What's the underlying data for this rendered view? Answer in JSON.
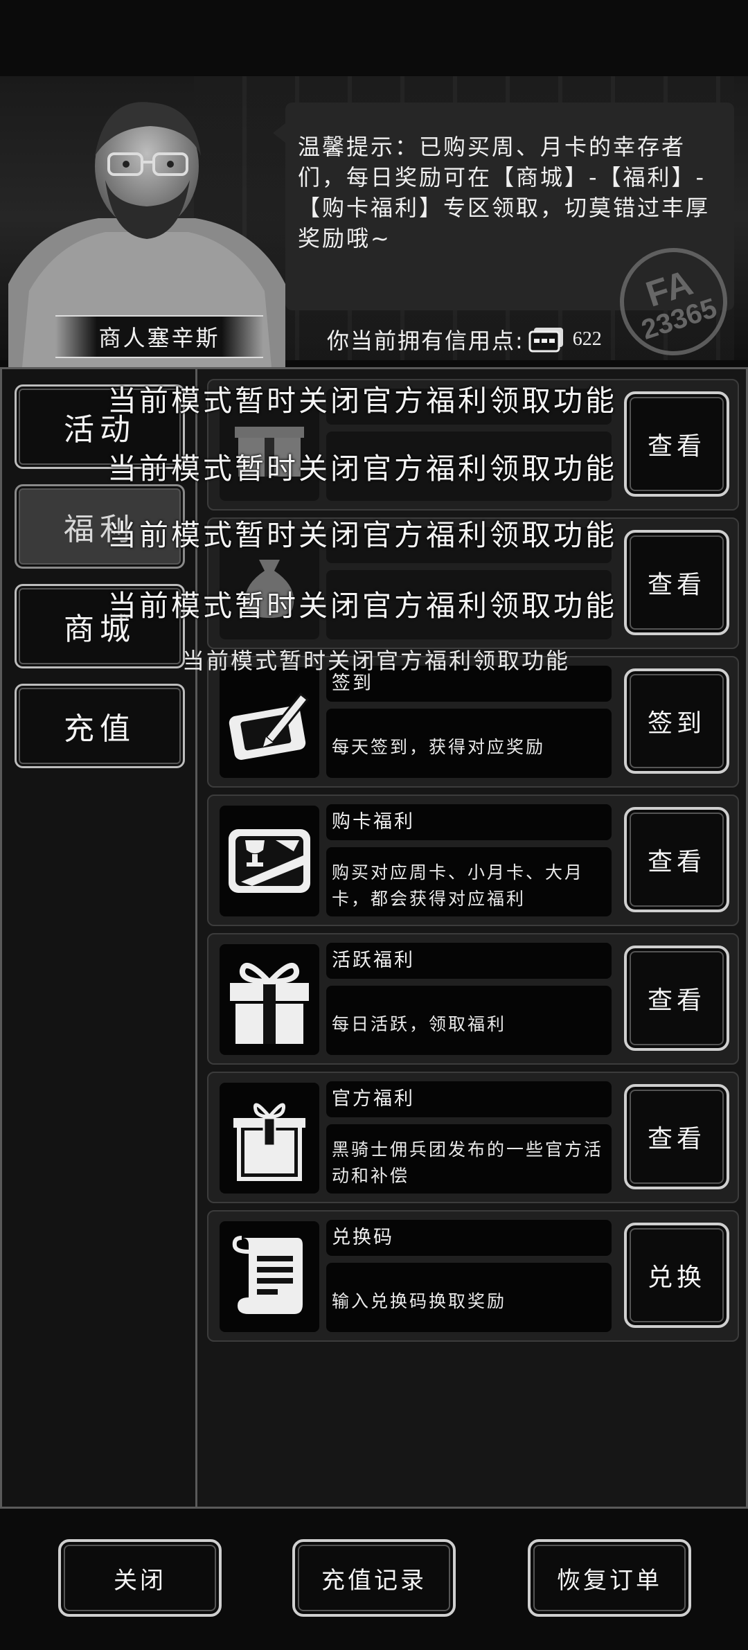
{
  "merchant": {
    "name": "商人塞辛斯",
    "tip": "温馨提示：已购买周、月卡的幸存者们，每日奖励可在【商城】-【福利】-【购卡福利】专区领取，切莫错过丰厚奖励哦~",
    "stamp_top": "FA",
    "stamp_bottom": "23365"
  },
  "credits": {
    "label": "你当前拥有信用点:",
    "amount": "622"
  },
  "sidebar": {
    "items": [
      {
        "label": "活动"
      },
      {
        "label": "福利"
      },
      {
        "label": "商城"
      },
      {
        "label": "充值"
      }
    ]
  },
  "overlay": {
    "message": "当前模式暂时关闭官方福利领取功能",
    "message_small": "当前模式暂时关闭官方福利领取功能"
  },
  "rows": [
    {
      "title": "",
      "desc": "",
      "action": "查看",
      "icon": "gift-box-icon"
    },
    {
      "title": "",
      "desc": "",
      "action": "查看",
      "icon": "money-bag-icon"
    },
    {
      "title": "签到",
      "desc": "每天签到，获得对应奖励",
      "action": "签到",
      "icon": "tablet-pen-icon"
    },
    {
      "title": "购卡福利",
      "desc": "购买对应周卡、小月卡、大月卡，都会获得对应福利",
      "action": "查看",
      "icon": "trophy-card-icon"
    },
    {
      "title": "活跃福利",
      "desc": "每日活跃，领取福利",
      "action": "查看",
      "icon": "gift-icon"
    },
    {
      "title": "官方福利",
      "desc": "黑骑士佣兵团发布的一些官方活动和补偿",
      "action": "查看",
      "icon": "package-icon"
    },
    {
      "title": "兑换码",
      "desc": "输入兑换码换取奖励",
      "action": "兑换",
      "icon": "scroll-icon"
    }
  ],
  "bottom": {
    "close": "关闭",
    "recharge_history": "充值记录",
    "restore_order": "恢复订单"
  }
}
